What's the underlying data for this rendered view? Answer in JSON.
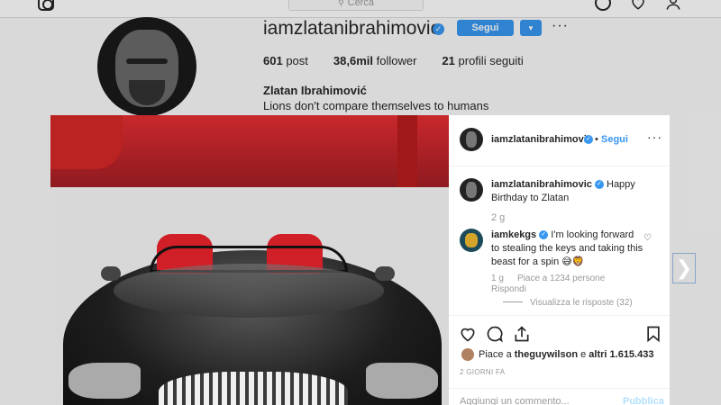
{
  "nav": {
    "search_placeholder": "Cerca"
  },
  "profile": {
    "username": "iamzlatanibrahimovic",
    "follow_label": "Segui",
    "more": "···",
    "posts_count": "601",
    "posts_label": "post",
    "followers_count": "38,6mil",
    "followers_label": "follower",
    "following_count": "21",
    "following_label": "profili seguiti",
    "full_name": "Zlatan Ibrahimović",
    "bio": "Lions don't compare themselves to humans"
  },
  "post": {
    "author": "iamzlatanibrahimovic",
    "dot": "•",
    "follow_label": "Segui",
    "more": "···",
    "caption_user": "iamzlatanibrahimovic",
    "caption_text": "Happy Birthday to Zlatan",
    "caption_time": "2 g",
    "comment": {
      "user": "iamkekgs",
      "text": "I'm looking forward to stealing the keys and taking this beast for a spin 😅🦁",
      "time": "1 g",
      "likes": "Piace a 1234 persone",
      "reply": "Rispondi",
      "view_replies": "Visualizza le risposte (32)"
    },
    "liked_by_prefix": "Piace a",
    "liked_by_user": "theguywilson",
    "liked_by_suffix": "e",
    "liked_by_others": "altri 1.615.433",
    "date": "2 GIORNI FA",
    "comment_placeholder": "Aggiungi un commento...",
    "publish_label": "Pubblica"
  },
  "icons": {
    "instagram_logo": "instagram-logo-icon",
    "explore": "compass-icon",
    "activity": "heart-icon",
    "profile": "user-icon",
    "next": "chevron-right-icon"
  },
  "colors": {
    "accent": "#3897f0",
    "car_seat": "#d01f26"
  }
}
